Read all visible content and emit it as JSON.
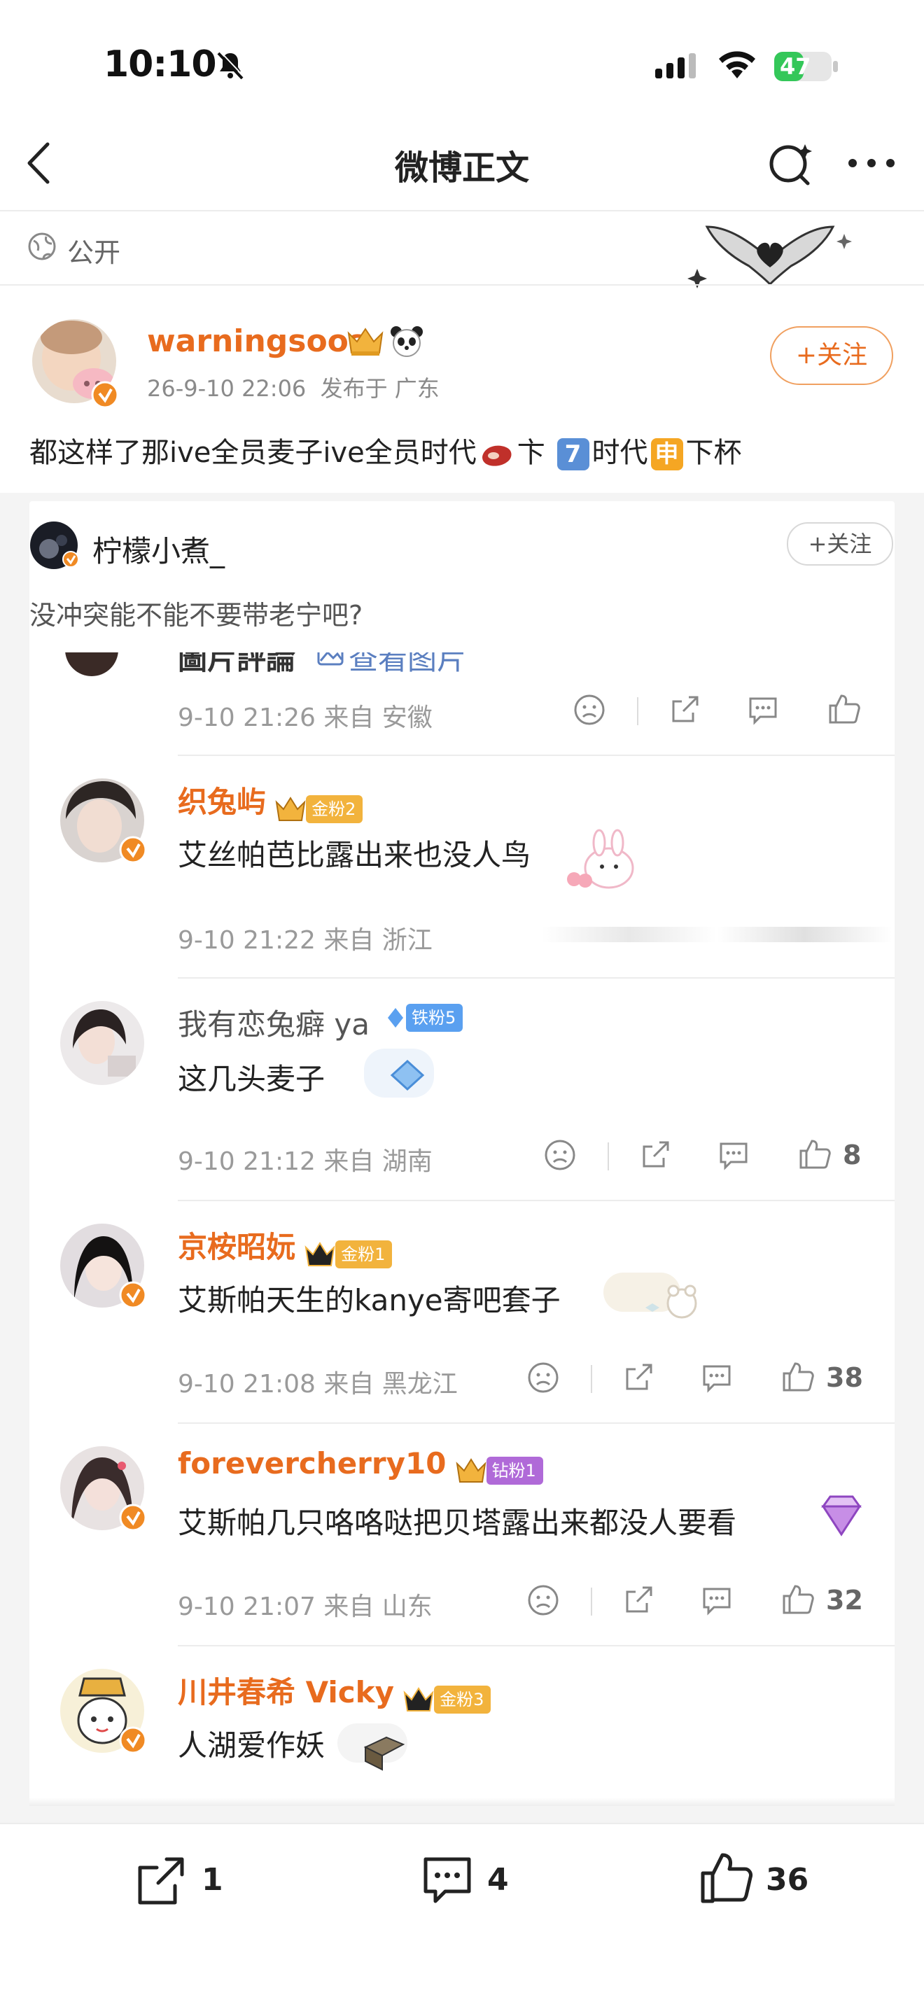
{
  "status_bar": {
    "time": "10:10",
    "battery": "47"
  },
  "nav": {
    "title": "微博正文"
  },
  "visibility": {
    "label": "公开"
  },
  "post": {
    "username": "warningsoos",
    "date": "26-9-10 22:06",
    "location_label": "发布于 广东",
    "follow_label": "+关注",
    "text_part1": "都这样了那ive全员麦子ive全员时代",
    "text_part2": "卞",
    "box1": "7",
    "text_part3": "时代",
    "box2": "申",
    "text_part4": "下杯"
  },
  "repost": {
    "username": "柠檬小煮_",
    "follow_label": "+关注",
    "text": "没冲突能不能不要带老宁吧?"
  },
  "comments_top": {
    "partial_text": "圖片評論",
    "view_image": "查看图片",
    "meta": "9-10 21:26 来自 安徽"
  },
  "comments": [
    {
      "name": "织兔屿",
      "badge": "金粉2",
      "text": "艾丝帕芭比露出来也没人鸟",
      "meta": "9-10 21:22 来自 浙江",
      "likes": ""
    },
    {
      "name": "我有恋兔癖 ya",
      "badge": "铁粉5",
      "text": "这几头麦子",
      "meta": "9-10 21:12 来自 湖南",
      "likes": "8"
    },
    {
      "name": "京桉昭妧",
      "badge": "金粉1",
      "text": "艾斯帕天生的kanye寄吧套子",
      "meta": "9-10 21:08 来自 黑龙江",
      "likes": "38"
    },
    {
      "name": "forevercherry10",
      "badge": "钻粉1",
      "text": "艾斯帕几只咯咯哒把贝塔露出来都没人要看",
      "meta": "9-10 21:07 来自 山东",
      "likes": "32"
    },
    {
      "name": "川井春希 Vicky",
      "badge": "金粉3",
      "text": "人湖爱作妖",
      "meta": "",
      "likes": ""
    }
  ],
  "bottom_bar": {
    "reposts": "1",
    "comments": "4",
    "likes": "36"
  },
  "colors": {
    "accent": "#e86b1e",
    "gold_badge": "#f2b33d",
    "iron_badge": "#5aa0f0",
    "diamond_badge": "#b06ad8"
  }
}
